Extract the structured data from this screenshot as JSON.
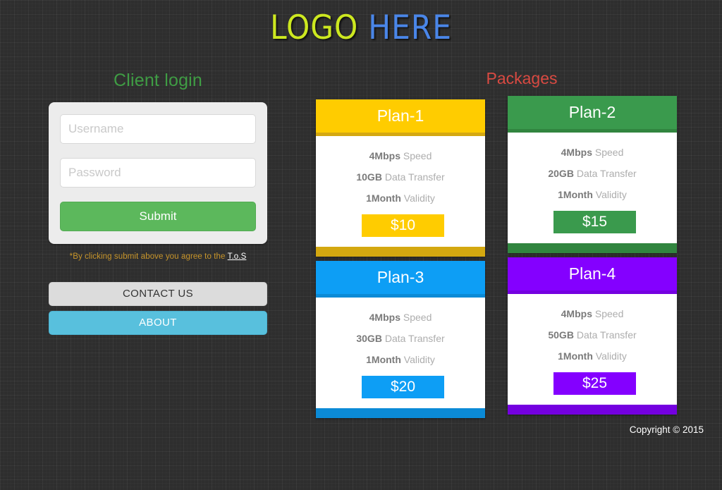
{
  "logo": {
    "part_a": "LOGO",
    "part_b": "HERE",
    "color_a": "#cde820",
    "color_b": "#4a86e8"
  },
  "login": {
    "title": "Client login",
    "title_color": "#3f9c44",
    "username": {
      "value": "",
      "placeholder": "Username"
    },
    "password": {
      "value": "",
      "placeholder": "Password"
    },
    "submit_label": "Submit",
    "submit_color": "#5cb85c",
    "tos_prefix": "*By clicking submit above you agree to the ",
    "tos_link": "T.o.S",
    "tos_color": "#c8952a",
    "buttons": [
      {
        "label": "CONTACT US",
        "style": "contact",
        "bg": "#dcdcdc"
      },
      {
        "label": "ABOUT",
        "style": "about",
        "bg": "#58c0dd"
      }
    ]
  },
  "packages": {
    "title": "Packages",
    "title_color": "#d94a42",
    "cards": [
      {
        "name": "Plan-1",
        "color": "#ffcc00",
        "strip_color": "#d4a810",
        "foot_color": "#d4a810",
        "price": "$10",
        "features": [
          {
            "value": "4Mbps",
            "label": " Speed"
          },
          {
            "value": "10GB",
            "label": " Data Transfer"
          },
          {
            "value": "1Month",
            "label": " Validity"
          }
        ]
      },
      {
        "name": "Plan-2",
        "color": "#3a9a4d",
        "strip_color": "#31853f",
        "foot_color": "#31853f",
        "price": "$15",
        "features": [
          {
            "value": "4Mbps",
            "label": " Speed"
          },
          {
            "value": "20GB",
            "label": " Data Transfer"
          },
          {
            "value": "1Month",
            "label": " Validity"
          }
        ]
      },
      {
        "name": "Plan-3",
        "color": "#0d9ef5",
        "strip_color": "#0b8ad6",
        "foot_color": "#0b8ad6",
        "price": "$20",
        "features": [
          {
            "value": "4Mbps",
            "label": " Speed"
          },
          {
            "value": "30GB",
            "label": " Data Transfer"
          },
          {
            "value": "1Month",
            "label": " Validity"
          }
        ]
      },
      {
        "name": "Plan-4",
        "color": "#8400ff",
        "strip_color": "#7400e0",
        "foot_color": "#7400e0",
        "price": "$25",
        "features": [
          {
            "value": "4Mbps",
            "label": " Speed"
          },
          {
            "value": "50GB",
            "label": " Data Transfer"
          },
          {
            "value": "1Month",
            "label": " Validity"
          }
        ]
      }
    ]
  },
  "footer": {
    "copyright": "Copyright © 2015"
  },
  "theme": {
    "background": "#2e2e2e",
    "panel": "#ececec"
  }
}
